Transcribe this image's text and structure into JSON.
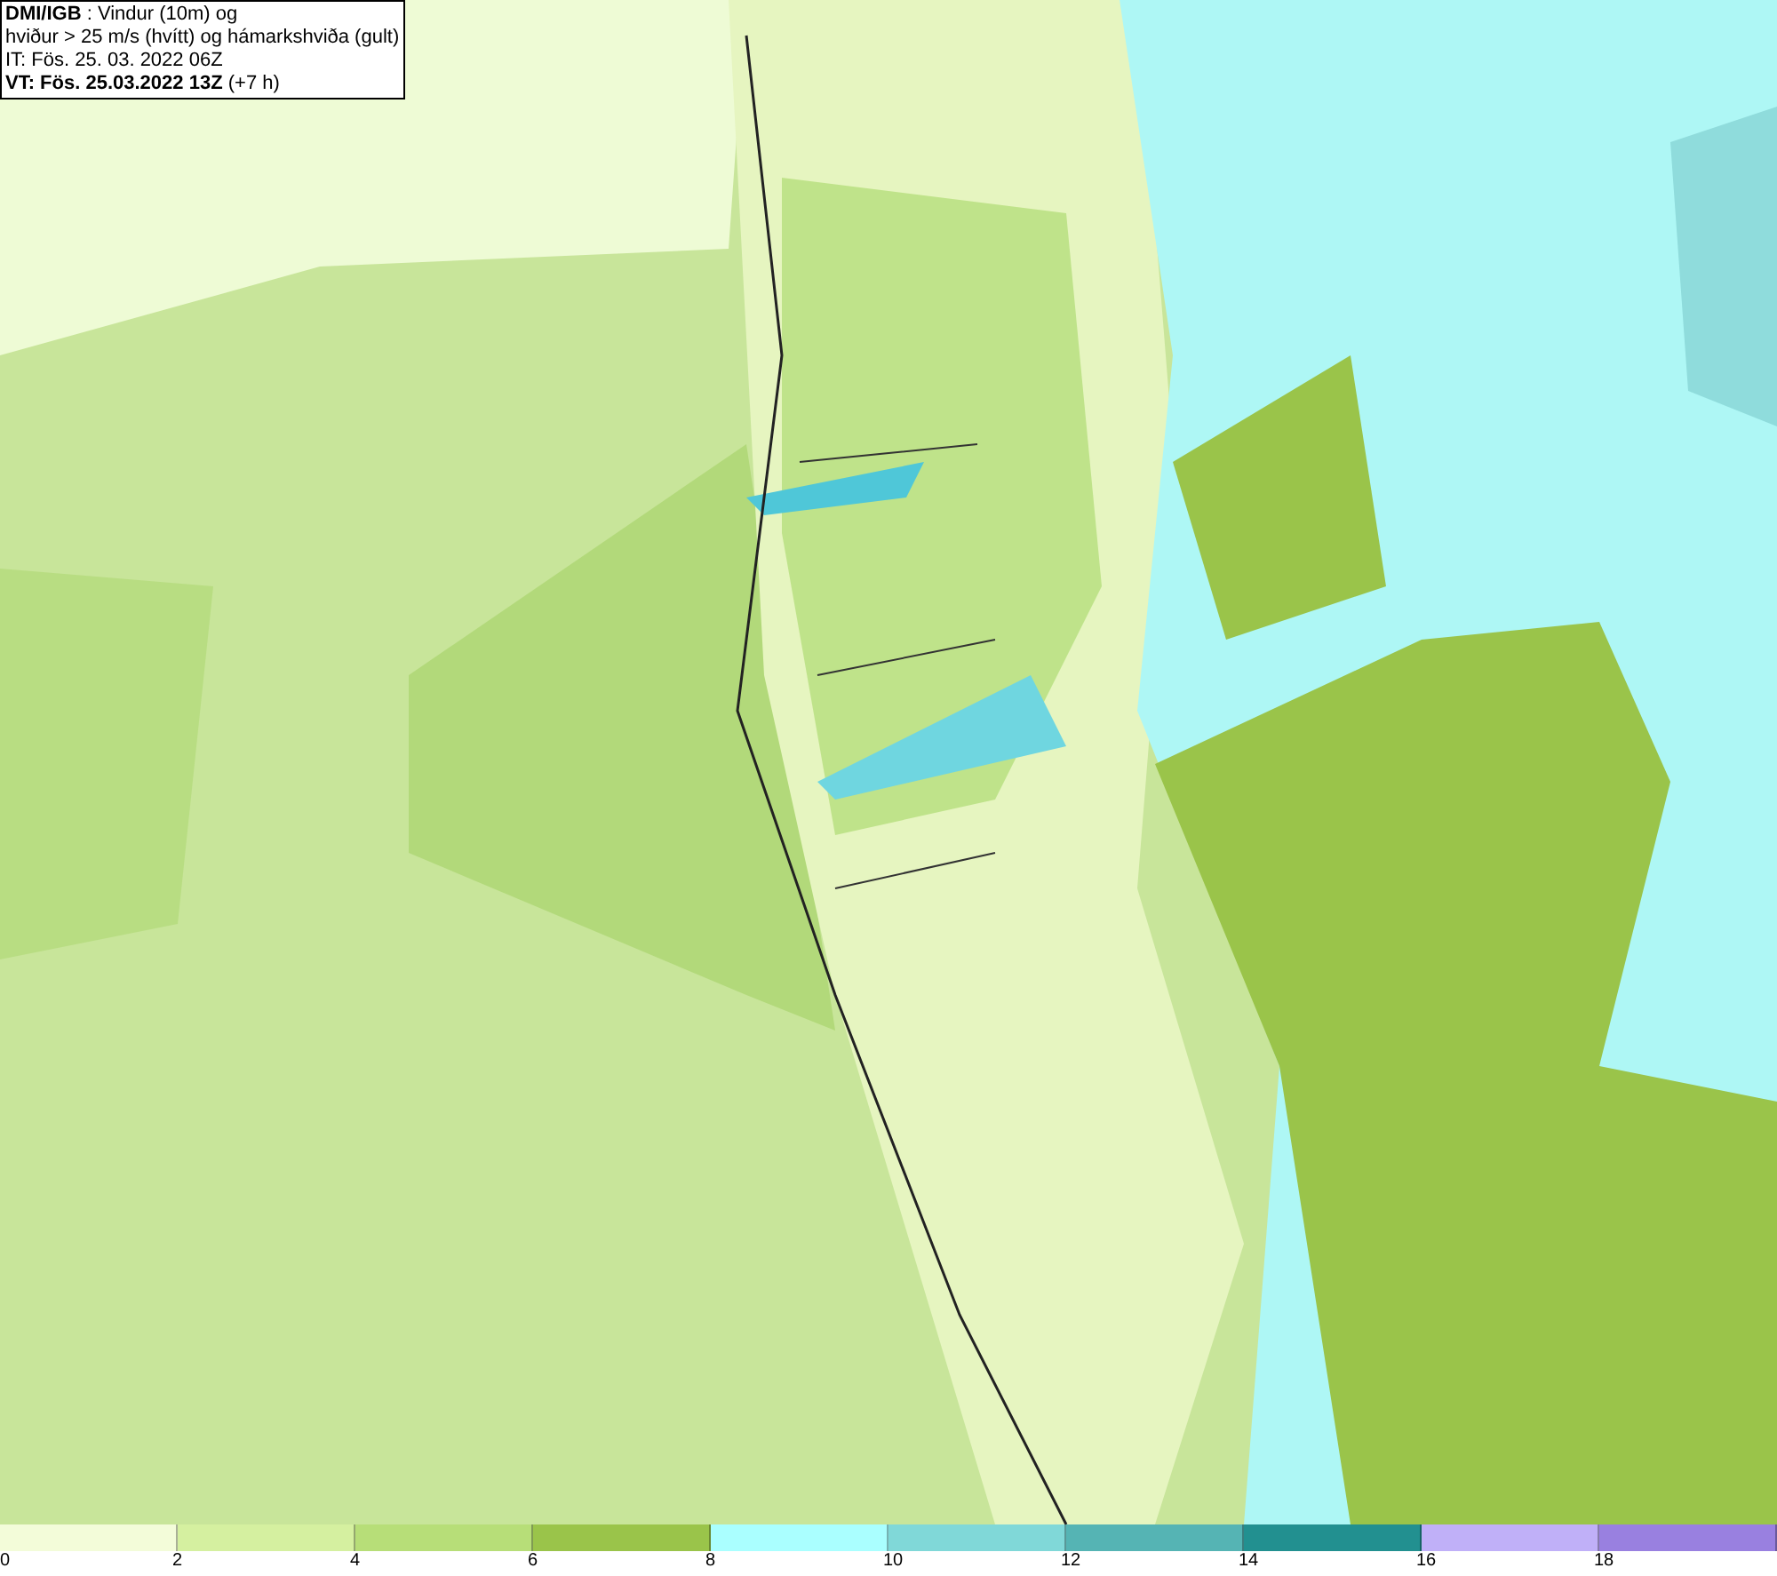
{
  "info_box": {
    "lines": [
      "**DMI/IGB** : Vindur (10m) og",
      "hviður > 25 m/s (hvítt) og hámarkshviða (gult)",
      "IT: Fös. 25. 03. 2022 06Z",
      "**VT: Fös. 25.03.2022 13Z** (+7 h)"
    ]
  },
  "legend": {
    "bins": [
      {
        "color": "#f3fcd9"
      },
      {
        "color": "#d5f0a0"
      },
      {
        "color": "#b7de78"
      },
      {
        "color": "#9ac44a"
      },
      {
        "color": "#aaffff"
      },
      {
        "color": "#80d8d8"
      },
      {
        "color": "#55b4b4"
      },
      {
        "color": "#229090"
      },
      {
        "color": "#c0b0f8"
      },
      {
        "color": "#9980e0"
      }
    ],
    "labels": [
      "0",
      "2",
      "4",
      "6",
      "8",
      "10",
      "12",
      "14",
      "16",
      "18"
    ]
  }
}
